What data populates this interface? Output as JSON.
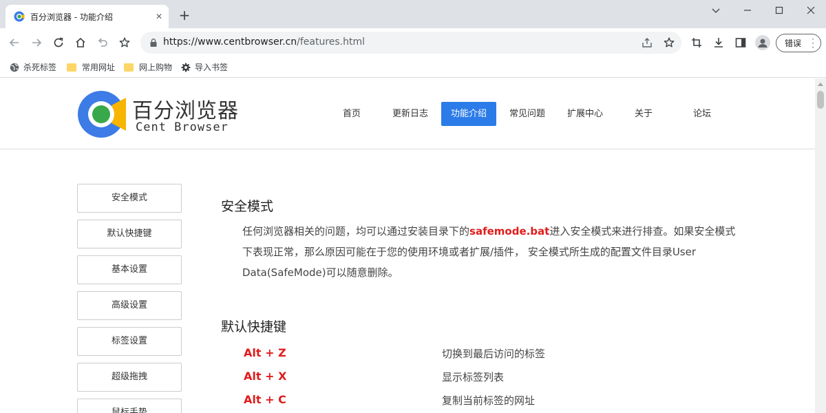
{
  "browser": {
    "tab": {
      "title": "百分浏览器 - 功能介绍"
    },
    "address": {
      "scheme_host": "https://www.centbrowser.cn",
      "path": "/features.html"
    },
    "profile_button": {
      "label": "错误"
    },
    "bookmarks": [
      {
        "label": "杀死标签",
        "icon": "globe-icon"
      },
      {
        "label": "常用网址",
        "icon": "folder-icon"
      },
      {
        "label": "网上购物",
        "icon": "folder-icon"
      },
      {
        "label": "导入书签",
        "icon": "gear-icon"
      }
    ]
  },
  "site": {
    "logo_cn": "百分浏览器",
    "logo_en": "Cent Browser",
    "nav": [
      {
        "label": "首页",
        "active": false
      },
      {
        "label": "更新日志",
        "active": false
      },
      {
        "label": "功能介绍",
        "active": true
      },
      {
        "label": "常见问题",
        "active": false
      },
      {
        "label": "扩展中心",
        "active": false
      },
      {
        "label": "关于",
        "active": false
      },
      {
        "label": "论坛",
        "active": false
      }
    ],
    "accent_color": "#2b7be8",
    "highlight_color": "#e01c1c"
  },
  "sidebar": {
    "items": [
      "安全模式",
      "默认快捷键",
      "基本设置",
      "高级设置",
      "标签设置",
      "超级拖拽",
      "鼠标手势"
    ]
  },
  "content": {
    "safe_mode": {
      "title": "安全模式",
      "text_before": "任何浏览器相关的问题，均可以通过安装目录下的",
      "highlight": "safemode.bat",
      "text_after": "进入安全模式来进行排查。如果安全模式下表现正常，那么原因可能在于您的使用环境或者扩展/插件， 安全模式所生成的配置文件目录User Data(SafeMode)可以随意删除。"
    },
    "shortcuts": {
      "title": "默认快捷键",
      "items": [
        {
          "key": "Alt + Z",
          "desc": "切换到最后访问的标签"
        },
        {
          "key": "Alt + X",
          "desc": "显示标签列表"
        },
        {
          "key": "Alt + C",
          "desc": "复制当前标签的网址"
        }
      ]
    }
  }
}
